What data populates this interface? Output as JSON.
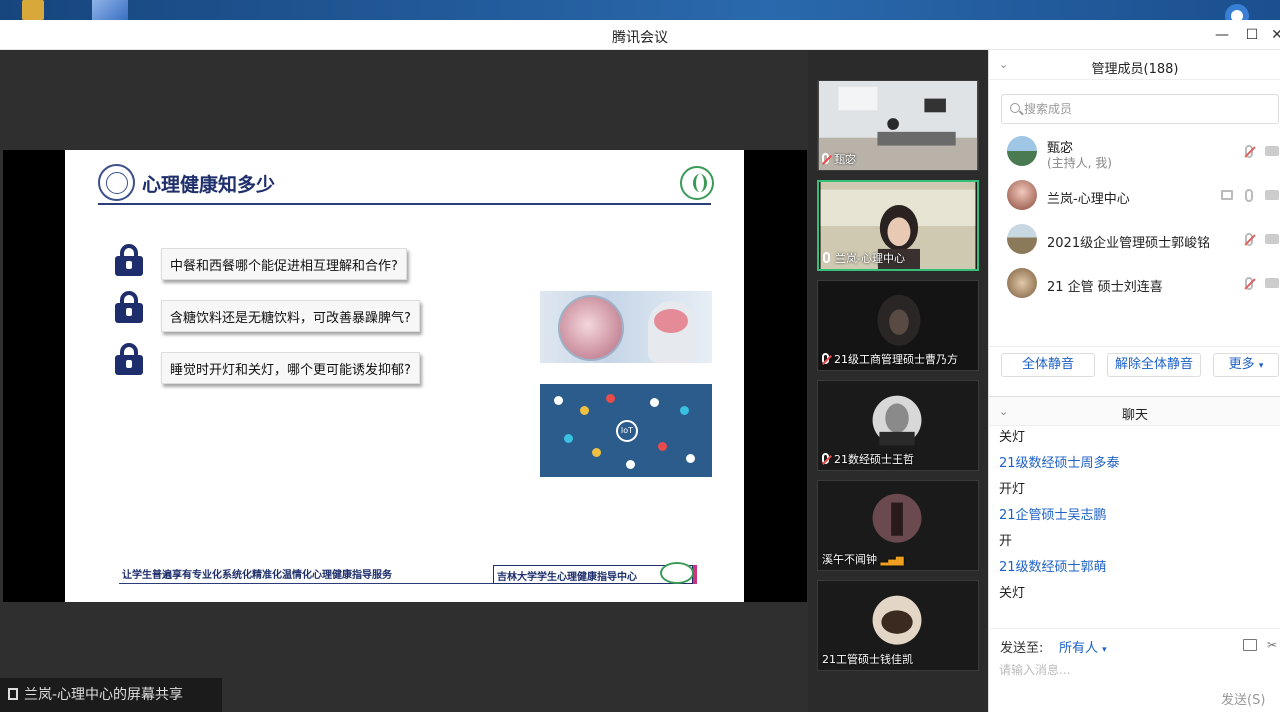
{
  "window": {
    "title": "腾讯会议"
  },
  "slide": {
    "title": "心理健康知多少",
    "questions": [
      "中餐和西餐哪个能促进相互理解和合作?",
      "含糖饮料还是无糖饮料，可改善暴躁脾气?",
      "睡觉时开灯和关灯，哪个更可能诱发抑郁?"
    ],
    "footer_left": "让学生普遍享有专业化系统化精准化温情化心理健康指导服务",
    "footer_right": "吉林大学学生心理健康指导中心"
  },
  "share_caption": "兰岚-心理中心的屏幕共享",
  "thumbnails": [
    {
      "name": "甄宓",
      "muted": true,
      "active": false
    },
    {
      "name": "兰岚-心理中心",
      "muted": false,
      "active": true
    },
    {
      "name": "21级工商管理硕士曹乃方",
      "muted": true,
      "active": false
    },
    {
      "name": "21数经硕士王哲",
      "muted": true,
      "active": false
    },
    {
      "name": "溪午不闻钟",
      "muted": false,
      "active": false
    },
    {
      "name": "21工管硕士钱佳凯",
      "muted": false,
      "active": false
    }
  ],
  "members_panel": {
    "title": "管理成员(188)",
    "search_placeholder": "搜索成员",
    "members": [
      {
        "name": "甄宓",
        "role": "(主持人, 我)"
      },
      {
        "name": "兰岚-心理中心"
      },
      {
        "name": "2021级企业管理硕士郭峻铭"
      },
      {
        "name": "21 企管 硕士刘连喜"
      }
    ],
    "btn_mute_all": "全体静音",
    "btn_unmute_all": "解除全体静音",
    "btn_more": "更多"
  },
  "chat": {
    "title": "聊天",
    "lines": [
      {
        "kind": "msg",
        "text": "关灯"
      },
      {
        "kind": "who",
        "text": "21级数经硕士周多泰"
      },
      {
        "kind": "msg",
        "text": "开灯"
      },
      {
        "kind": "who",
        "text": "21企管硕士吴志鹏"
      },
      {
        "kind": "msg",
        "text": "开"
      },
      {
        "kind": "who",
        "text": "21级数经硕士郭萌"
      },
      {
        "kind": "msg",
        "text": "关灯"
      }
    ],
    "send_to_label": "发送至:",
    "send_to_target": "所有人",
    "input_placeholder": "请输入消息...",
    "send_button": "发送(S)"
  },
  "colors": {
    "accent": "#1e62c7",
    "active_border": "#35c07a",
    "slide_navy": "#1e2f6b"
  }
}
